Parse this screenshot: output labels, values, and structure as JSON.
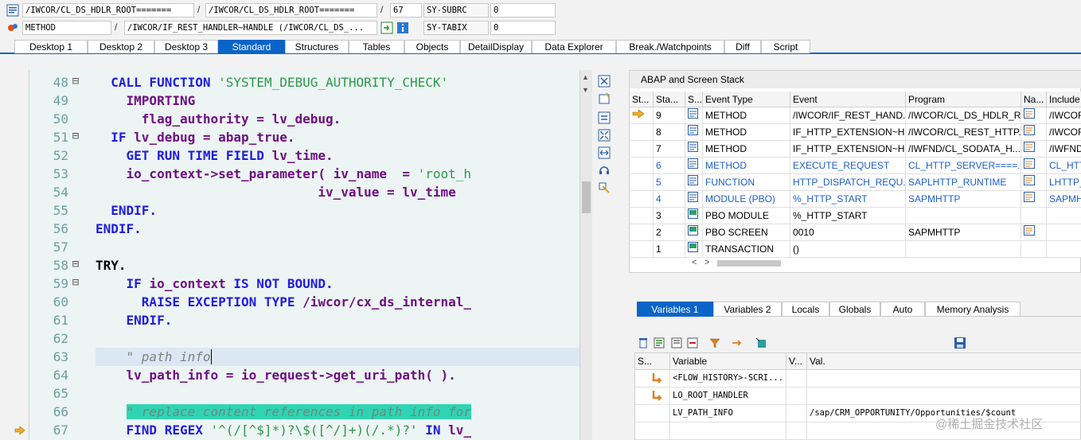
{
  "header": {
    "row1": {
      "program_field": "/IWCOR/CL_DS_HDLR_ROOT=======",
      "include_field": "/IWCOR/CL_DS_HDLR_ROOT=======",
      "line_field": "67",
      "sy_label": "SY-SUBRC",
      "sy_value": "0"
    },
    "row2": {
      "type_field": "METHOD",
      "method_field": "/IWCOR/IF_REST_HANDLER~HANDLE (/IWCOR/CL_DS_...",
      "sy_label": "SY-TABIX",
      "sy_value": "0"
    },
    "separator": "/"
  },
  "tabs": [
    "Desktop 1",
    "Desktop 2",
    "Desktop 3",
    "Standard",
    "Structures",
    "Tables",
    "Objects",
    "DetailDisplay",
    "Data Explorer",
    "Break./Watchpoints",
    "Diff",
    "Script"
  ],
  "active_tab": "Standard",
  "editor": {
    "line_numbers": [
      "48",
      "49",
      "50",
      "51",
      "52",
      "53",
      "54",
      "55",
      "56",
      "57",
      "58",
      "59",
      "60",
      "61",
      "62",
      "63",
      "64",
      "65",
      "66",
      "67"
    ],
    "current_line": "67"
  },
  "stack": {
    "title": "ABAP and Screen Stack",
    "columns": [
      "St...",
      "Sta...",
      "S...",
      "Event Type",
      "Event",
      "Program",
      "Na...",
      "Include"
    ],
    "rows": [
      {
        "level": "9",
        "type": "METHOD",
        "event": "/IWCOR/IF_REST_HAND...",
        "program": "/IWCOR/CL_DS_HDLR_R...",
        "include": "/IWCOR",
        "link": false,
        "current": true
      },
      {
        "level": "8",
        "type": "METHOD",
        "event": "IF_HTTP_EXTENSION~H...",
        "program": "/IWCOR/CL_REST_HTTP...",
        "include": "/IWCOR",
        "link": false,
        "current": false
      },
      {
        "level": "7",
        "type": "METHOD",
        "event": "IF_HTTP_EXTENSION~H...",
        "program": "/IWFND/CL_SODATA_H...",
        "include": "/IWFND",
        "link": false,
        "current": false
      },
      {
        "level": "6",
        "type": "METHOD",
        "event": "EXECUTE_REQUEST",
        "program": "CL_HTTP_SERVER====...",
        "include": "CL_HTT",
        "link": true,
        "current": false
      },
      {
        "level": "5",
        "type": "FUNCTION",
        "event": "HTTP_DISPATCH_REQU...",
        "program": "SAPLHTTP_RUNTIME",
        "include": "LHTTP_",
        "link": true,
        "current": false
      },
      {
        "level": "4",
        "type": "MODULE (PBO)",
        "event": "%_HTTP_START",
        "program": "SAPMHTTP",
        "include": "SAPMH",
        "link": true,
        "current": false
      },
      {
        "level": "3",
        "type": "PBO MODULE",
        "event": "%_HTTP_START",
        "program": "",
        "include": "",
        "link": false,
        "current": false
      },
      {
        "level": "2",
        "type": "PBO SCREEN",
        "event": "0010",
        "program": "SAPMHTTP",
        "include": "",
        "link": false,
        "current": false
      },
      {
        "level": "1",
        "type": "TRANSACTION",
        "event": "()",
        "program": "",
        "include": "",
        "link": false,
        "current": false
      }
    ]
  },
  "var_tabs": [
    "Variables 1",
    "Variables 2",
    "Locals",
    "Globals",
    "Auto",
    "Memory Analysis"
  ],
  "active_var_tab": "Variables 1",
  "variables": {
    "columns": [
      "S...",
      "Variable",
      "V...",
      "Val."
    ],
    "rows": [
      {
        "name": "<FLOW_HISTORY>-SCRI...",
        "value": ""
      },
      {
        "name": "LO_ROOT_HANDLER",
        "value": ""
      },
      {
        "name": "LV_PATH_INFO",
        "value": "/sap/CRM_OPPORTUNITY/Opportunities/$count"
      },
      {
        "name": "",
        "value": ""
      }
    ]
  },
  "watermark": "@稀土掘金技术社区"
}
